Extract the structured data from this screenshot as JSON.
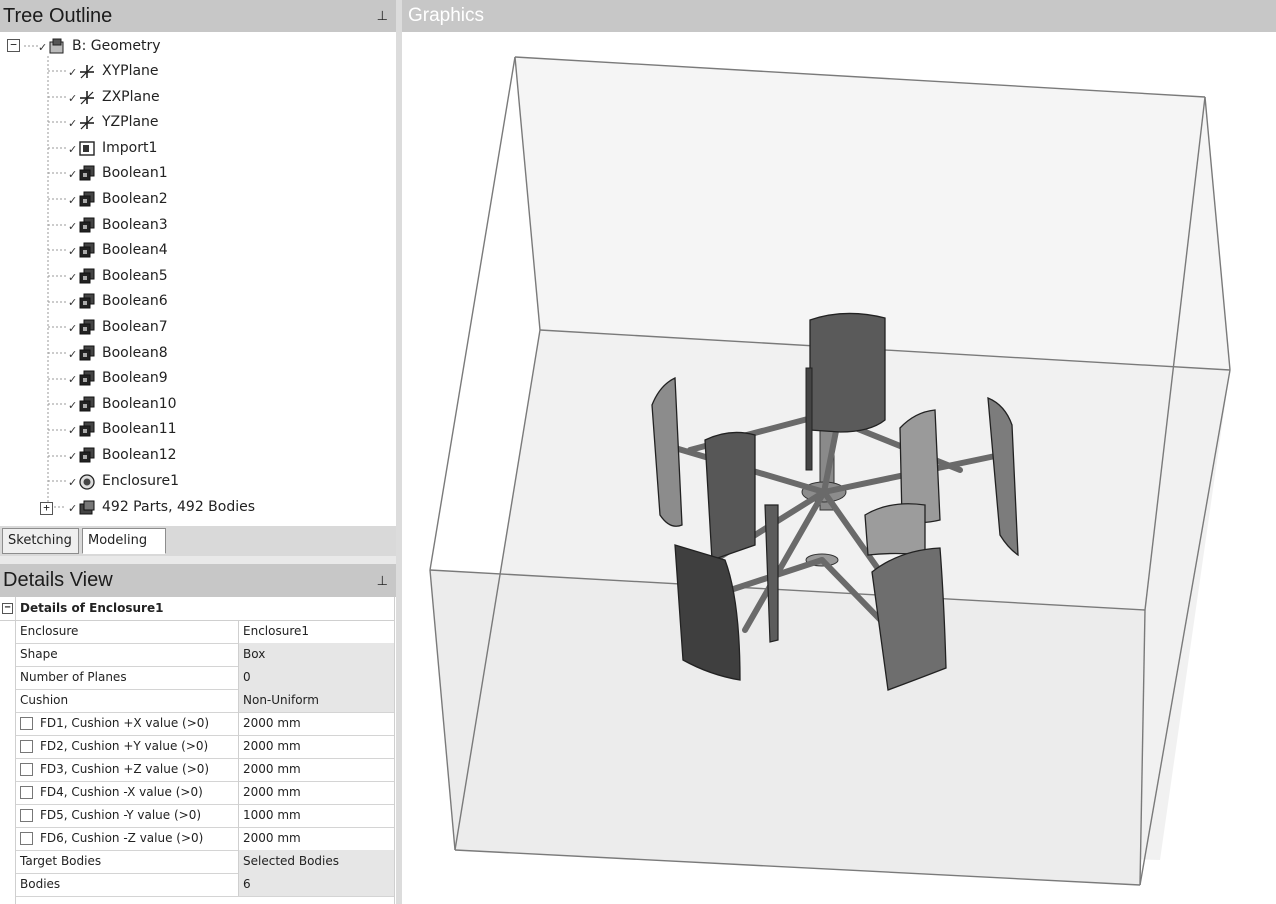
{
  "tree_outline": {
    "title": "Tree Outline",
    "pin": "⊥",
    "root": {
      "label": "B: Geometry",
      "expander": "−"
    },
    "items": [
      {
        "label": "XYPlane",
        "icon": "plane-icon"
      },
      {
        "label": "ZXPlane",
        "icon": "plane-icon"
      },
      {
        "label": "YZPlane",
        "icon": "plane-icon"
      },
      {
        "label": "Import1",
        "icon": "import-icon"
      },
      {
        "label": "Boolean1",
        "icon": "boolean-icon"
      },
      {
        "label": "Boolean2",
        "icon": "boolean-icon"
      },
      {
        "label": "Boolean3",
        "icon": "boolean-icon"
      },
      {
        "label": "Boolean4",
        "icon": "boolean-icon"
      },
      {
        "label": "Boolean5",
        "icon": "boolean-icon"
      },
      {
        "label": "Boolean6",
        "icon": "boolean-icon"
      },
      {
        "label": "Boolean7",
        "icon": "boolean-icon"
      },
      {
        "label": "Boolean8",
        "icon": "boolean-icon"
      },
      {
        "label": "Boolean9",
        "icon": "boolean-icon"
      },
      {
        "label": "Boolean10",
        "icon": "boolean-icon"
      },
      {
        "label": "Boolean11",
        "icon": "boolean-icon"
      },
      {
        "label": "Boolean12",
        "icon": "boolean-icon"
      },
      {
        "label": "Enclosure1",
        "icon": "enclosure-icon"
      }
    ],
    "parts": {
      "label": "492 Parts, 492 Bodies",
      "expander": "+",
      "icon": "bodies-icon"
    }
  },
  "tabs": [
    {
      "label": "Sketching"
    },
    {
      "label": "Modeling"
    }
  ],
  "graphics": {
    "title": "Graphics"
  },
  "details_view": {
    "title": "Details View",
    "pin": "⊥",
    "group": {
      "label": "Details of Enclosure1",
      "expander": "−"
    },
    "rows": [
      {
        "key": "Enclosure",
        "value": "Enclosure1"
      },
      {
        "key": "Shape",
        "value": "Box"
      },
      {
        "key": "Number of Planes",
        "value": "0"
      },
      {
        "key": "Cushion",
        "value": "Non-Uniform"
      },
      {
        "key": "FD1, Cushion +X value (>0)",
        "value": "2000 mm"
      },
      {
        "key": "FD2, Cushion +Y value (>0)",
        "value": "2000 mm"
      },
      {
        "key": "FD3, Cushion +Z value (>0)",
        "value": "2000 mm"
      },
      {
        "key": "FD4, Cushion -X value (>0)",
        "value": "2000 mm"
      },
      {
        "key": "FD5, Cushion -Y value (>0)",
        "value": "1000 mm"
      },
      {
        "key": "FD6, Cushion -Z value (>0)",
        "value": "2000 mm"
      },
      {
        "key": "Target Bodies",
        "value": "Selected Bodies"
      },
      {
        "key": "Bodies",
        "value": "6"
      }
    ]
  }
}
